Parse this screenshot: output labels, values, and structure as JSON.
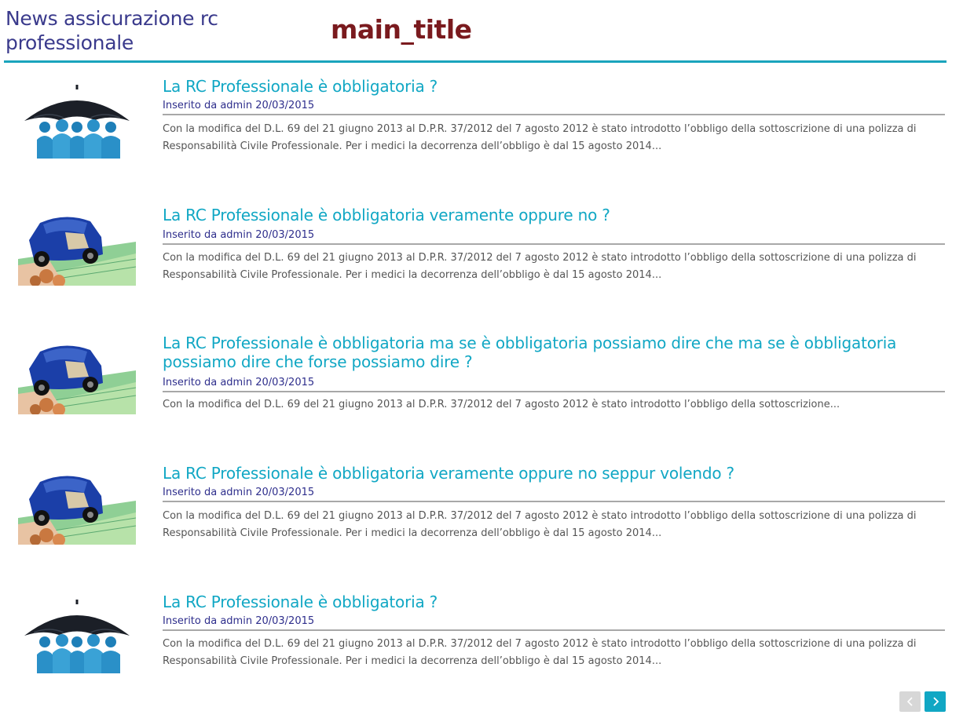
{
  "header": {
    "site_title": "News assicurazione rc professionale",
    "main_title": "main_title"
  },
  "news": [
    {
      "image": "umbrella-people-icon",
      "title": "La RC Professionale è obbligatoria ?",
      "meta": "Inserito da admin 20/03/2015",
      "excerpt": "Con la modifica del D.L. 69 del 21 giugno 2013 al D.P.R. 37/2012 del 7 agosto 2012 è stato introdotto l’obbligo della sottoscrizione di una polizza di Responsabilità Civile Professionale. Per i medici la decorrenza dell’obbligo è dal 15 agosto 2014..."
    },
    {
      "image": "car-money-icon",
      "title": "La RC Professionale è obbligatoria veramente oppure no ?",
      "meta": "Inserito da admin 20/03/2015",
      "excerpt": "Con la modifica del D.L. 69 del 21 giugno 2013 al D.P.R. 37/2012 del 7 agosto 2012 è stato introdotto l’obbligo della sottoscrizione di una polizza di Responsabilità Civile Professionale. Per i medici la decorrenza dell’obbligo è dal 15 agosto 2014..."
    },
    {
      "image": "car-money-icon",
      "title": "La RC Professionale è obbligatoria ma se è obbligatoria possiamo dire che ma se è obbligatoria possiamo dire che forse possiamo dire ?",
      "meta": "Inserito da admin 20/03/2015",
      "excerpt": "Con la modifica del D.L. 69 del 21 giugno 2013 al D.P.R. 37/2012 del 7 agosto 2012 è stato introdotto l’obbligo della sottoscrizione..."
    },
    {
      "image": "car-money-icon",
      "title": "La RC Professionale è obbligatoria veramente oppure no seppur volendo ?",
      "meta": "Inserito da admin 20/03/2015",
      "excerpt": "Con la modifica del D.L. 69 del 21 giugno 2013 al D.P.R. 37/2012 del 7 agosto 2012 è stato introdotto l’obbligo della sottoscrizione di una polizza di Responsabilità Civile Professionale. Per i medici la decorrenza dell’obbligo è dal 15 agosto 2014..."
    },
    {
      "image": "umbrella-people-icon",
      "title": "La RC Professionale è obbligatoria ?",
      "meta": "Inserito da admin 20/03/2015",
      "excerpt": "Con la modifica del D.L. 69 del 21 giugno 2013 al D.P.R. 37/2012 del 7 agosto 2012 è stato introdotto l’obbligo della sottoscrizione di una polizza di Responsabilità Civile Professionale. Per i medici la decorrenza dell’obbligo è dal 15 agosto 2014..."
    }
  ],
  "pager": {
    "prev_icon": "chevron-left-icon",
    "next_icon": "chevron-right-icon"
  },
  "colors": {
    "accent": "#11a7c4",
    "site_title": "#3a3a8c",
    "main_title": "#7a1a1e",
    "meta": "#2e2e8c",
    "excerpt": "#555555"
  }
}
